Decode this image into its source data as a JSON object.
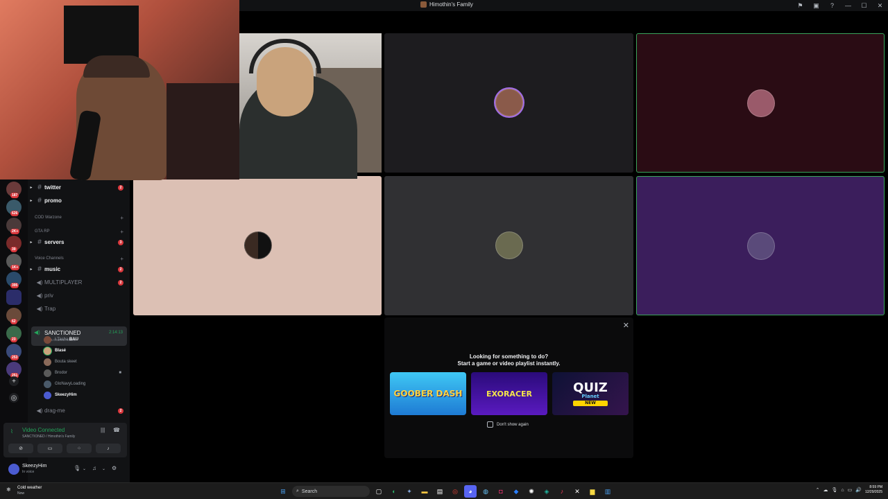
{
  "window": {
    "title": "Himothin's Family",
    "title_icons": [
      "flag-icon",
      "inbox-icon",
      "help-icon",
      "minimize-icon",
      "maximize-icon",
      "close-icon"
    ]
  },
  "servers": [
    {
      "badge": "187"
    },
    {
      "badge": "626"
    },
    {
      "badge": "2K+"
    },
    {
      "badge": "39"
    },
    {
      "badge": "1K+"
    },
    {
      "badge": "395"
    },
    {
      "badge": ""
    },
    {
      "badge": "62"
    },
    {
      "badge": "23"
    },
    {
      "badge": "253"
    },
    {
      "badge": "251"
    }
  ],
  "sidebar": {
    "channels_top": [
      {
        "name": "twitter",
        "badge": "2"
      },
      {
        "name": "promo",
        "badge": ""
      }
    ],
    "cat_cod": "COD Warzone",
    "cat_gta": "GTA RP",
    "servers_channel": {
      "name": "servers",
      "badge": "3"
    },
    "cat_voice": "Voice Channels",
    "voice_text": {
      "name": "music",
      "badge": "2"
    },
    "voice_channels": [
      {
        "name": "MULTIPLAYER",
        "badge": "2"
      },
      {
        "name": "priv",
        "badge": ""
      },
      {
        "name": "Trap",
        "badge": ""
      }
    ],
    "active_channel": {
      "name": "SANCTIONED",
      "timer": "2:14:13",
      "status": "Set a channel status"
    },
    "members": [
      {
        "name": "I Tasha",
        "tag": "BAU"
      },
      {
        "name": "Blasé"
      },
      {
        "name": "Bouta skeet"
      },
      {
        "name": "Brodor"
      },
      {
        "name": "GloNavyLoading"
      },
      {
        "name": "SkeezyHim"
      }
    ],
    "drag_me": {
      "name": "drag-me",
      "badge": "2"
    }
  },
  "voice_panel": {
    "title": "Video Connected",
    "subtitle": "SANCTIONED / Himothin's Family"
  },
  "user": {
    "name": "SkeezyHim",
    "status": "In voice"
  },
  "activity": {
    "heading": "Looking for something to do?",
    "subheading": "Start a game or video playlist instantly.",
    "games": [
      {
        "name": "GOOBER DASH"
      },
      {
        "name": "EXORACER"
      },
      {
        "name": "QUIZ",
        "sub": "Planet",
        "tag": "NEW"
      }
    ],
    "dont_show": "Don't show again"
  },
  "taskbar": {
    "weather_title": "Cold weather",
    "weather_sub": "Now",
    "search_label": "Search",
    "time": "8:59 PM",
    "date": "12/29/2025"
  },
  "colors": {
    "accent_green": "#23a55a",
    "badge_red": "#da373c",
    "tile_peach": "#dcc0b4",
    "tile_maroon": "#2a0c14",
    "tile_purple": "#3b1e5c"
  }
}
